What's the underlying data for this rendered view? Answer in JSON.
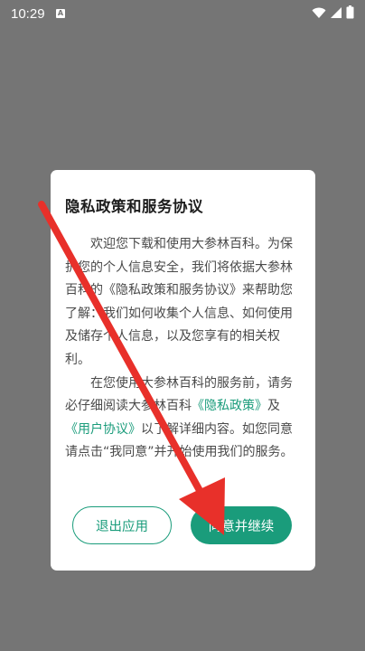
{
  "status_bar": {
    "time": "10:29",
    "notification_letter": "A"
  },
  "dialog": {
    "title": "隐私政策和服务协议",
    "paragraph1": "欢迎您下载和使用大参林百科。为保护您的个人信息安全，我们将依据大参林百科的《隐私政策和服务协议》来帮助您了解：我们如何收集个人信息、如何使用及储存个人信息，以及您享有的相关权利。",
    "paragraph2_before": "在您使用大参林百科的服务前，请务必仔细阅读大参林百科",
    "privacy_link": "《隐私政策》",
    "paragraph2_and": "及",
    "user_agreement_link": "《用户协议》",
    "paragraph2_after": "以了解详细内容。如您同意请点击“我同意”并开始使用我们的服务。",
    "exit_button": "退出应用",
    "agree_button": "同意并继续"
  },
  "colors": {
    "accent": "#1a9c7b",
    "overlay": "#757575",
    "annotation_arrow": "#e8302a"
  },
  "icons": {
    "status_right": [
      "wifi-icon",
      "signal-icon",
      "battery-icon"
    ],
    "annotation": "red-arrow-pointing-to-agree-button"
  }
}
